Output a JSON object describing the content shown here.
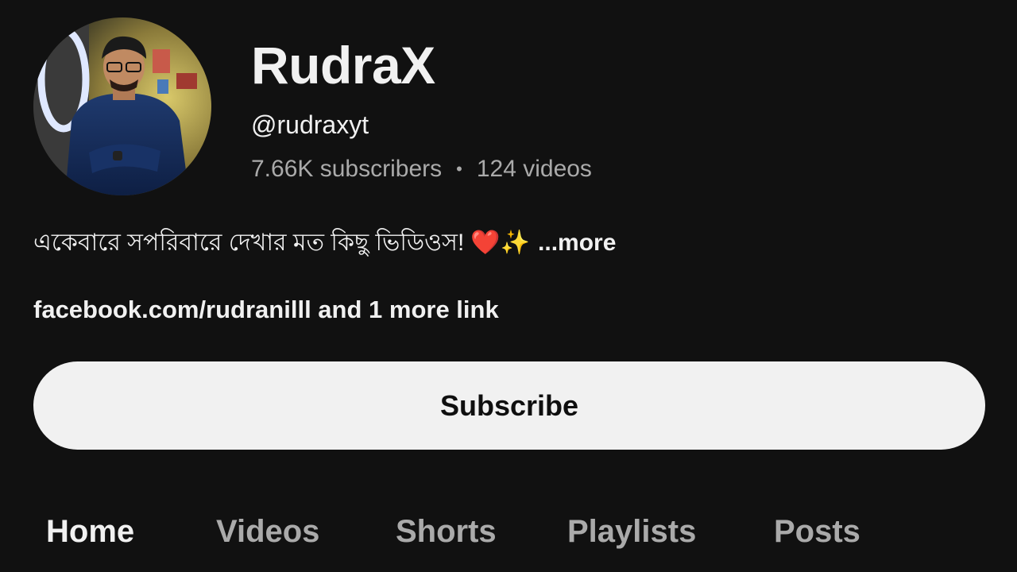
{
  "channel": {
    "name": "RudraX",
    "handle": "@rudraxyt",
    "subscribers": "7.66K subscribers",
    "separator": "•",
    "videos": "124 videos",
    "description": "একেবারে সপরিবারে দেখার মত কিছু ভিডিওস!",
    "description_emoji": "❤️✨",
    "more_label": "...more",
    "links_text": "facebook.com/rudranilll and 1 more link"
  },
  "actions": {
    "subscribe_label": "Subscribe"
  },
  "tabs": [
    {
      "label": "Home",
      "active": true
    },
    {
      "label": "Videos",
      "active": false
    },
    {
      "label": "Shorts",
      "active": false
    },
    {
      "label": "Playlists",
      "active": false
    },
    {
      "label": "Posts",
      "active": false
    }
  ],
  "colors": {
    "background": "#111111",
    "primary_text": "#f1f1f1",
    "secondary_text": "#aaaaaa",
    "button_bg": "#f1f1f1",
    "button_text": "#0f0f0f"
  }
}
